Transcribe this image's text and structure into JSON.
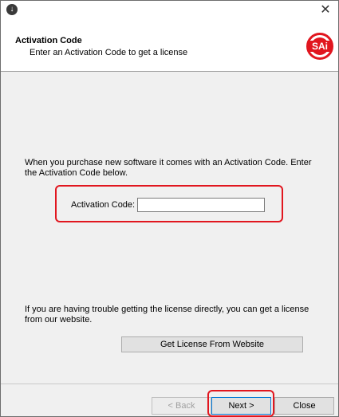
{
  "window": {
    "close_glyph": "✕"
  },
  "header": {
    "title": "Activation Code",
    "subtitle": "Enter an Activation Code to get a license",
    "logo_text": "SAi",
    "logo_color": "#e1161f"
  },
  "main": {
    "intro": "When you purchase new software it comes with an Activation Code.  Enter the Activation Code below.",
    "activation_label": "Activation Code:",
    "activation_value": "",
    "trouble_text": "If you are having trouble getting the license directly, you can get a license from our website.",
    "website_button": "Get License From Website"
  },
  "footer": {
    "back_label": "< Back",
    "next_label": "Next >",
    "close_label": "Close"
  },
  "highlight_color": "#e1161f"
}
